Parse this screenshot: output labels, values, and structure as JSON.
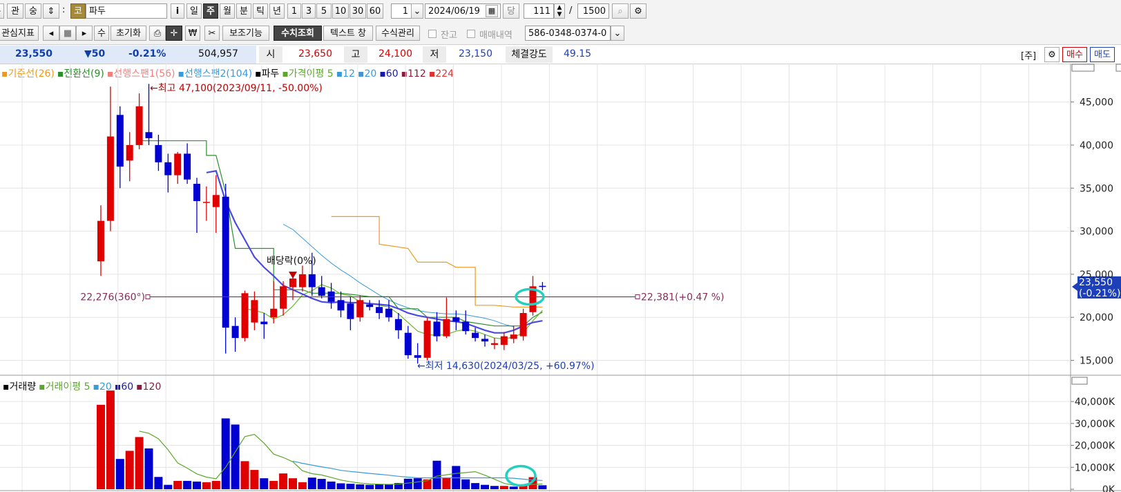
{
  "toolbar1": {
    "btn_a": "관",
    "btn_b": "숭",
    "code_badge": "코",
    "stock_name": "파두",
    "info_btn": "i",
    "periods": [
      "일",
      "주",
      "월",
      "분",
      "틱",
      "년"
    ],
    "active_period": "주",
    "intervals": [
      "1",
      "3",
      "5",
      "10",
      "30",
      "60"
    ],
    "count_select": "1",
    "date": "2024/06/19",
    "today_btn": "당",
    "count_value": "111",
    "slash": "/",
    "max_count": "1500"
  },
  "toolbar2": {
    "interest_indicator": "관심지표",
    "num_btn": "수",
    "reset_btn": "초기화",
    "aux_btn": "보조기능",
    "value_query_btn": "수치조회",
    "text_window_btn": "텍스트 창",
    "formula_btn": "수식관리",
    "balance_label": "잔고",
    "trade_history_label": "매매내역",
    "account": "586-0348-0374-0"
  },
  "quote": {
    "price": "23,550",
    "change": "▼50",
    "change_pct": "-0.21%",
    "volume": "504,957",
    "open_label": "시",
    "open": "23,650",
    "high_label": "고",
    "high": "24,100",
    "low_label": "저",
    "low": "23,150",
    "strength_label": "체결강도",
    "strength": "49.15",
    "bracket_label": "[주]",
    "buy_btn": "매수",
    "sell_btn": "매도"
  },
  "legend_price": [
    {
      "text": "기준선(26)",
      "color": "#f09a1c"
    },
    {
      "text": "전환선(9)",
      "color": "#2a8f2a"
    },
    {
      "text": "선행스팬1(56)",
      "color": "#f08080"
    },
    {
      "text": "선행스팬2(104)",
      "color": "#3a9ad8"
    },
    {
      "text": "파두",
      "color": "#000000"
    },
    {
      "text": "가격이평 5",
      "color": "#5aa82a"
    },
    {
      "text": "12",
      "color": "#3a9ad8"
    },
    {
      "text": "20",
      "color": "#3a9ad8"
    },
    {
      "text": "60",
      "color": "#1a1aa8"
    },
    {
      "text": "112",
      "color": "#8a1a3a"
    },
    {
      "text": "224",
      "color": "#e03030"
    }
  ],
  "legend_volume": [
    {
      "text": "거래량",
      "color": "#000000"
    },
    {
      "text": "거래이평 5",
      "color": "#5aa82a"
    },
    {
      "text": "20",
      "color": "#3a9ad8"
    },
    {
      "text": "60",
      "color": "#1a1aa8"
    },
    {
      "text": "120",
      "color": "#8a1a3a"
    }
  ],
  "annotations": {
    "high_note": "←최고 47,100(2023/09/11, -50.00%)",
    "low_note": "←최저 14,630(2024/03/25, +60.97%)",
    "dividend_note": "배당락(0%)",
    "line_left": "22,276(360°)",
    "line_right": "22,381(+0.47 %)",
    "current_price": "23,550",
    "current_pct": "(-0.21%)"
  },
  "chart_data": [
    {
      "type": "candlestick",
      "title": "파두",
      "ylim": [
        14000,
        48500
      ],
      "yticks": [
        "45,000",
        "40,000",
        "35,000",
        "30,000",
        "25,000",
        "20,000",
        "15,000"
      ],
      "ytick_values": [
        45000,
        40000,
        35000,
        30000,
        25000,
        20000,
        15000
      ],
      "candles": [
        {
          "o": 26500,
          "h": 33000,
          "l": 24800,
          "c": 31200
        },
        {
          "o": 31200,
          "h": 46800,
          "l": 30000,
          "c": 41000
        },
        {
          "o": 43500,
          "h": 44500,
          "l": 35000,
          "c": 37500
        },
        {
          "o": 38200,
          "h": 41500,
          "l": 35800,
          "c": 40000
        },
        {
          "o": 40000,
          "h": 46000,
          "l": 39500,
          "c": 44500
        },
        {
          "o": 41500,
          "h": 47100,
          "l": 40000,
          "c": 40800
        },
        {
          "o": 40000,
          "h": 41200,
          "l": 37000,
          "c": 38000
        },
        {
          "o": 38000,
          "h": 39000,
          "l": 34500,
          "c": 36500
        },
        {
          "o": 36500,
          "h": 39200,
          "l": 35500,
          "c": 39000
        },
        {
          "o": 39000,
          "h": 40200,
          "l": 35500,
          "c": 36000
        },
        {
          "o": 35500,
          "h": 36200,
          "l": 29800,
          "c": 33500
        },
        {
          "o": 33400,
          "h": 35200,
          "l": 31200,
          "c": 33400
        },
        {
          "o": 32800,
          "h": 36500,
          "l": 29800,
          "c": 34200
        },
        {
          "o": 34000,
          "h": 35500,
          "l": 15800,
          "c": 18800
        },
        {
          "o": 19000,
          "h": 20000,
          "l": 16000,
          "c": 17600
        },
        {
          "o": 17600,
          "h": 23100,
          "l": 17200,
          "c": 22800
        },
        {
          "o": 19400,
          "h": 23000,
          "l": 18500,
          "c": 22000
        },
        {
          "o": 19500,
          "h": 20500,
          "l": 17500,
          "c": 19200
        },
        {
          "o": 20000,
          "h": 24200,
          "l": 19300,
          "c": 21000
        },
        {
          "o": 21000,
          "h": 24200,
          "l": 20200,
          "c": 23600
        },
        {
          "o": 23500,
          "h": 25000,
          "l": 22000,
          "c": 24500
        },
        {
          "o": 23500,
          "h": 26000,
          "l": 23000,
          "c": 25000
        },
        {
          "o": 25000,
          "h": 27500,
          "l": 22500,
          "c": 23500
        },
        {
          "o": 23500,
          "h": 24800,
          "l": 22200,
          "c": 22500
        },
        {
          "o": 23000,
          "h": 24000,
          "l": 21000,
          "c": 21800
        },
        {
          "o": 22000,
          "h": 23000,
          "l": 20000,
          "c": 20800
        },
        {
          "o": 21600,
          "h": 22400,
          "l": 18500,
          "c": 19800
        },
        {
          "o": 20000,
          "h": 22500,
          "l": 19500,
          "c": 22000
        },
        {
          "o": 21500,
          "h": 22000,
          "l": 20800,
          "c": 21200
        },
        {
          "o": 21200,
          "h": 22000,
          "l": 19800,
          "c": 20500
        },
        {
          "o": 21000,
          "h": 22000,
          "l": 19500,
          "c": 20000
        },
        {
          "o": 19800,
          "h": 20500,
          "l": 17500,
          "c": 18500
        },
        {
          "o": 18200,
          "h": 19000,
          "l": 15200,
          "c": 15600
        },
        {
          "o": 15600,
          "h": 17000,
          "l": 14630,
          "c": 15300
        },
        {
          "o": 15300,
          "h": 20000,
          "l": 15000,
          "c": 19600
        },
        {
          "o": 19500,
          "h": 20600,
          "l": 17200,
          "c": 17800
        },
        {
          "o": 17800,
          "h": 22300,
          "l": 17600,
          "c": 19800
        },
        {
          "o": 20000,
          "h": 20800,
          "l": 18500,
          "c": 19500
        },
        {
          "o": 19500,
          "h": 20800,
          "l": 18000,
          "c": 18400
        },
        {
          "o": 18200,
          "h": 18800,
          "l": 17200,
          "c": 17600
        },
        {
          "o": 17500,
          "h": 18000,
          "l": 16600,
          "c": 17200
        },
        {
          "o": 16800,
          "h": 17600,
          "l": 16300,
          "c": 17000
        },
        {
          "o": 16800,
          "h": 18300,
          "l": 16200,
          "c": 17800
        },
        {
          "o": 17500,
          "h": 19000,
          "l": 17000,
          "c": 18000
        },
        {
          "o": 17800,
          "h": 21000,
          "l": 17300,
          "c": 20500
        },
        {
          "o": 20600,
          "h": 24800,
          "l": 20200,
          "c": 23600
        },
        {
          "o": 23650,
          "h": 24100,
          "l": 23150,
          "c": 23550
        }
      ],
      "ma_green": [
        null,
        null,
        null,
        null,
        null,
        null,
        null,
        null,
        null,
        null,
        null,
        null,
        null,
        null,
        null,
        21000,
        20800,
        20500,
        19800,
        20300,
        21300,
        22600,
        23100,
        23800,
        23400,
        22700,
        22500,
        21800,
        21600,
        21400,
        21200,
        20400,
        19400,
        18400,
        18000,
        17900,
        18000,
        18400,
        18600,
        18400,
        18000,
        17600,
        17500,
        17700,
        18200,
        19600,
        20800
      ],
      "ma_blue": [
        null,
        null,
        null,
        null,
        null,
        null,
        null,
        null,
        null,
        null,
        null,
        36800,
        37000,
        33500,
        31000,
        29000,
        27000,
        25800,
        24800,
        23700,
        23200,
        22700,
        22200,
        21800,
        21700,
        21800,
        21700,
        21700,
        21600,
        21500,
        21400,
        21000,
        20500,
        20200,
        20000,
        19800,
        19600,
        19500,
        19300,
        18900,
        18500,
        18200,
        18200,
        18500,
        19000,
        19400,
        19600
      ],
      "line_tenkan": [
        null,
        null,
        null,
        null,
        null,
        null,
        null,
        null,
        null,
        null,
        null,
        null,
        null,
        null,
        null,
        null,
        null,
        null,
        null,
        null,
        null,
        null,
        null,
        null,
        null,
        null,
        null,
        null,
        null,
        null,
        null,
        null,
        null,
        null,
        null,
        null,
        null,
        null,
        null,
        null,
        null,
        null,
        null,
        null,
        null,
        null,
        null
      ],
      "leading_span2": [
        null,
        null,
        null,
        null,
        null,
        null,
        null,
        null,
        null,
        null,
        null,
        null,
        null,
        null,
        null,
        null,
        null,
        null,
        null,
        null,
        null,
        null,
        null,
        null,
        null,
        null,
        null,
        null,
        null,
        null,
        30500,
        30000,
        29000,
        28000,
        27000,
        26000,
        25200,
        24500,
        23700,
        22800,
        21800,
        20900,
        20500,
        20100,
        19700,
        null,
        null
      ],
      "base_line": [
        null,
        null,
        null,
        null,
        null,
        null,
        null,
        null,
        null,
        null,
        null,
        null,
        null,
        null,
        null,
        null,
        null,
        null,
        null,
        null,
        null,
        null,
        null,
        null,
        null,
        null,
        null,
        null,
        null,
        null,
        null,
        null,
        null,
        null,
        null,
        null,
        null,
        null,
        null,
        null,
        null,
        null,
        null,
        null,
        null,
        null,
        null
      ],
      "dividend_index": 20,
      "price_line": 22381
    },
    {
      "type": "bar",
      "title": "거래량",
      "ylim": [
        0,
        46000
      ],
      "yticks": [
        "40,000K",
        "30,000K",
        "20,000K",
        "10,000K",
        "0K"
      ],
      "ytick_values": [
        40000,
        30000,
        20000,
        10000,
        0
      ],
      "volumes": [
        38500,
        45000,
        13800,
        17500,
        23800,
        18600,
        5600,
        2000,
        3800,
        3800,
        3500,
        3200,
        3800,
        32300,
        29500,
        12800,
        8800,
        5000,
        3800,
        7200,
        5000,
        3200,
        5300,
        4700,
        3500,
        2700,
        2500,
        2200,
        2000,
        2300,
        2300,
        2800,
        4800,
        5000,
        4500,
        13000,
        5200,
        10600,
        4500,
        2800,
        2000,
        1500,
        1500,
        1200,
        2000,
        5500,
        1800
      ],
      "colors_up": [
        true,
        true,
        false,
        true,
        true,
        false,
        false,
        false,
        true,
        false,
        false,
        true,
        true,
        false,
        false,
        true,
        true,
        false,
        true,
        true,
        true,
        true,
        false,
        false,
        false,
        false,
        false,
        false,
        false,
        false,
        false,
        false,
        false,
        false,
        true,
        false,
        true,
        false,
        false,
        false,
        false,
        false,
        true,
        false,
        true,
        true,
        false
      ],
      "ma5": [
        null,
        null,
        null,
        null,
        26500,
        25500,
        23000,
        18000,
        12000,
        9600,
        7000,
        5500,
        4800,
        10000,
        17000,
        24000,
        25000,
        21000,
        16000,
        14500,
        12500,
        8400,
        7100,
        6500,
        5400,
        4200,
        3400,
        2800,
        2400,
        2300,
        2200,
        2300,
        2800,
        3300,
        3900,
        6000,
        6600,
        7200,
        7600,
        8000,
        6400,
        4600,
        2700,
        1800,
        1500,
        2200,
        2400
      ],
      "ma20": [
        null,
        null,
        null,
        null,
        null,
        null,
        null,
        null,
        null,
        null,
        null,
        null,
        null,
        null,
        null,
        null,
        null,
        null,
        null,
        null,
        12800,
        11800,
        11000,
        10200,
        9500,
        8600,
        8100,
        7700,
        7200,
        6800,
        6400,
        5900,
        5500,
        5200,
        5200,
        5200,
        5200,
        5200,
        5200,
        5200,
        5200,
        5200,
        5200,
        5000,
        4600,
        4200,
        4000
      ]
    }
  ]
}
